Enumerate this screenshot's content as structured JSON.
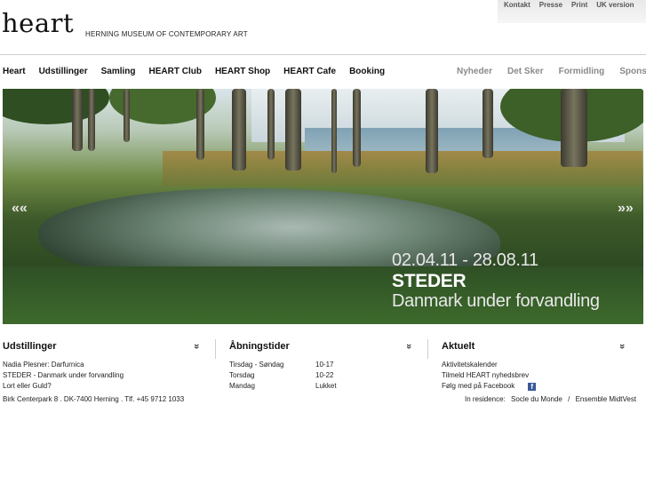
{
  "utility_nav": [
    "Kontakt",
    "Presse",
    "Print",
    "UK version"
  ],
  "logo": {
    "text": "heart",
    "subtitle": "HERNING MUSEUM OF CONTEMPORARY ART"
  },
  "main_nav": [
    "Heart",
    "Udstillinger",
    "Samling",
    "HEART Club",
    "HEART Shop",
    "HEART Cafe",
    "Booking"
  ],
  "secondary_nav": [
    "Nyheder",
    "Det Sker",
    "Formidling",
    "Sponsor"
  ],
  "hero": {
    "dates": "02.04.11 - 28.08.11",
    "title": "STEDER",
    "subtitle": "Danmark under forvandling",
    "prev_arrow": "««",
    "next_arrow": "»»"
  },
  "exhibitions": {
    "heading": "Udstillinger",
    "items": [
      "Nadia Plesner: Darfurnica",
      "STEDER - Danmark under forvandling",
      "Lort eller Guld?"
    ]
  },
  "opening_hours": {
    "heading": "Åbningstider",
    "rows": [
      {
        "day": "Tirsdag - Søndag",
        "time": "10-17"
      },
      {
        "day": "Torsdag",
        "time": "10-22"
      },
      {
        "day": "Mandag",
        "time": "Lukket"
      }
    ]
  },
  "news": {
    "heading": "Aktuelt",
    "items": [
      "Aktivitetskalender",
      "Tilmeld HEART nyhedsbrev",
      "Følg med på Facebook"
    ]
  },
  "chevron": "»",
  "footer": {
    "address": "Birk Centerpark 8 . DK-7400 Herning . Tlf. +45 9712 1033",
    "residence_label": "In residence:",
    "residence_1": "Socle du Monde",
    "separator": "/",
    "residence_2": "Ensemble MidtVest"
  },
  "colors": {
    "facebook": "#3b5998",
    "nav_secondary": "#8a8a8a"
  }
}
